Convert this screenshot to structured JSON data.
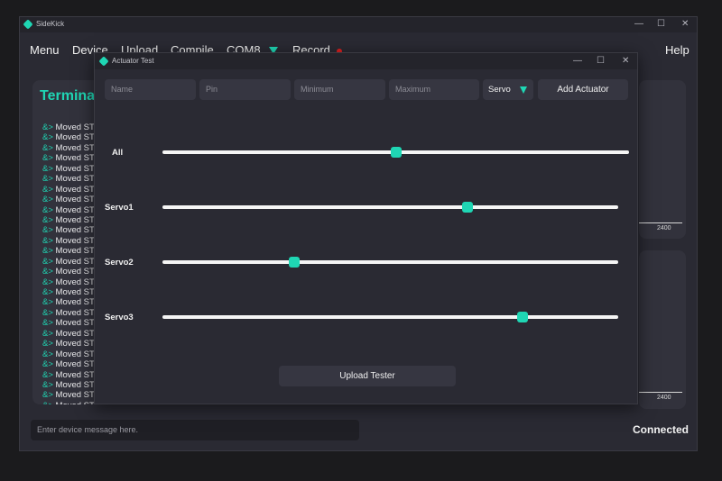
{
  "app": {
    "title": "SideKick",
    "status": "Connected"
  },
  "window_controls": {
    "minimize": "—",
    "maximize": "☐",
    "close": "✕"
  },
  "menu": {
    "menu": "Menu",
    "device": "Device",
    "upload": "Upload",
    "compile": "Compile",
    "port": "COM8",
    "record": "Record",
    "help": "Help"
  },
  "colors": {
    "accent": "#1fd6b4",
    "record": "#e02020",
    "background": "#2a2a33"
  },
  "terminal": {
    "title": "Terminal",
    "prefix": "&>",
    "lines": [
      "Moved STI",
      "Moved STI",
      "Moved STI",
      "Moved STI",
      "Moved STI",
      "Moved STI",
      "Moved STI",
      "Moved STI",
      "Moved STI",
      "Moved STI",
      "Moved STI",
      "Moved STI",
      "Moved STI",
      "Moved STI",
      "Moved STI",
      "Moved STI",
      "Moved STI",
      "Moved STI",
      "Moved STI",
      "Moved STI",
      "Moved STI",
      "Moved STI",
      "Moved STI",
      "Moved STI",
      "Moved STI",
      "Moved STI",
      "Moved STI",
      "Moved STI"
    ]
  },
  "graphs": [
    {
      "tick": "2400"
    },
    {
      "tick": "2400"
    }
  ],
  "message_input": {
    "placeholder": "Enter device message here."
  },
  "dialog": {
    "title": "Actuator Test",
    "fields": {
      "name": "Name",
      "pin": "Pin",
      "minimum": "Minimum",
      "maximum": "Maximum"
    },
    "type_select": "Servo",
    "add_label": "Add Actuator",
    "sliders": [
      {
        "label": "All",
        "value": 0.5
      },
      {
        "label": "Servo1",
        "value": 0.67
      },
      {
        "label": "Servo2",
        "value": 0.29
      },
      {
        "label": "Servo3",
        "value": 0.79
      }
    ],
    "upload_label": "Upload Tester"
  }
}
